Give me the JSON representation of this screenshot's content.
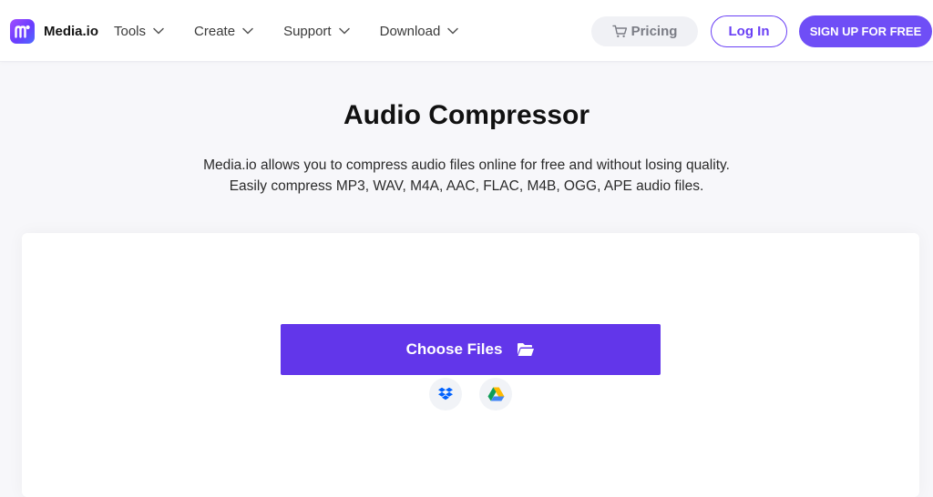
{
  "brand": {
    "name": "Media.io",
    "accent": "#6f4ef6"
  },
  "nav": {
    "items": [
      {
        "label": "Tools"
      },
      {
        "label": "Create"
      },
      {
        "label": "Support"
      },
      {
        "label": "Download"
      }
    ],
    "pricing_label": "Pricing",
    "login_label": "Log In",
    "signup_label": "SIGN UP FOR FREE"
  },
  "hero": {
    "title": "Audio Compressor",
    "subtitle_line1": "Media.io allows you to compress audio files online for free and without losing quality.",
    "subtitle_line2": "Easily compress MP3, WAV, M4A, AAC, FLAC, M4B, OGG, APE audio files."
  },
  "upload": {
    "choose_label": "Choose Files",
    "choose_color": "#6236ea",
    "cloud_sources": [
      "dropbox-icon",
      "google-drive-icon"
    ]
  }
}
